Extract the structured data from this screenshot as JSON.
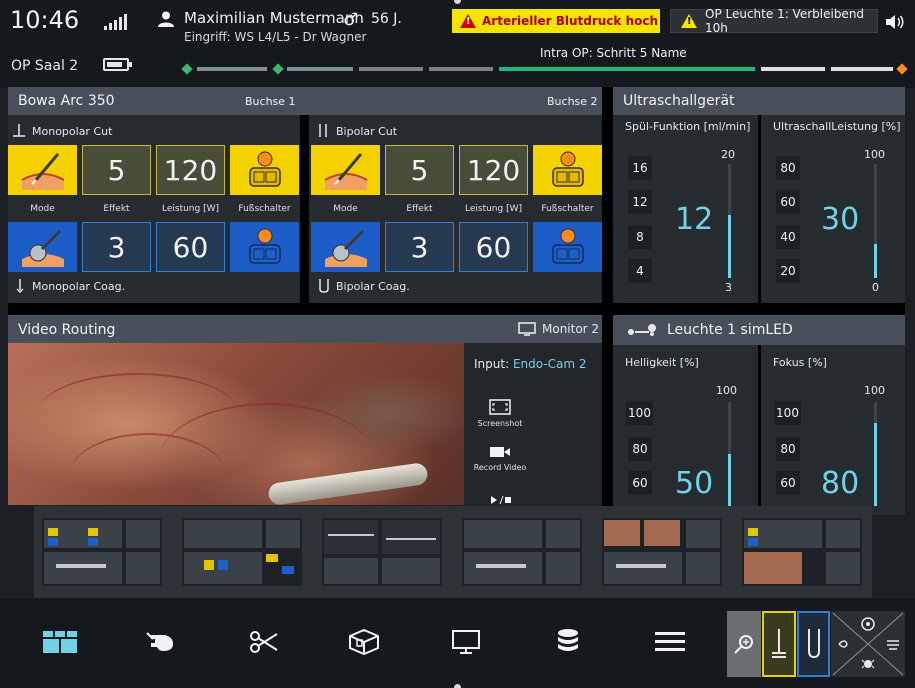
{
  "status": {
    "time": "10:46",
    "room": "OP Saal 2",
    "patient_name": "Maximilian Mustermann",
    "gender_symbol": "♂",
    "age": "56 J.",
    "procedure": "Eingriff: WS L4/L5 - Dr Wagner",
    "alarm_text": "Arterieller Blutdruck hoch",
    "warning_text": "OP Leuchte 1: Verbleibend 10h",
    "step_label": "Intra OP: Schritt 5 Name",
    "battery_level": 0.85,
    "signal_icon": "signal-icon",
    "speaker_icon": "speaker-icon",
    "colors": {
      "alarm_bg": "#f5e400",
      "alarm_text": "#b00000",
      "progress_active": "#1fb87a",
      "accent": "#6fd2e6"
    }
  },
  "hf": {
    "title": "Bowa Arc 350",
    "socket1": "Buchse 1",
    "socket2": "Buchse 2",
    "left": {
      "cut_mode": "Monopolar Cut",
      "coag_mode": "Monopolar Coag.",
      "cut_effect": "5",
      "cut_power": "120",
      "coag_effect": "3",
      "coag_power": "60"
    },
    "right": {
      "cut_mode": "Bipolar Cut",
      "coag_mode": "Bipolar Coag.",
      "cut_effect": "5",
      "cut_power": "120",
      "coag_effect": "3",
      "coag_power": "60"
    },
    "labels": {
      "mode": "Mode",
      "effect": "Effekt",
      "power": "Leistung [W]",
      "footswitch": "Fußschalter"
    }
  },
  "ultrasound": {
    "title": "Ultraschallgerät",
    "rinse": {
      "title": "Spül-Funktion  [ml/min]",
      "value": "12",
      "max": "20",
      "min": "3",
      "presets": [
        "16",
        "12",
        "8",
        "4"
      ],
      "level": 0.55
    },
    "power": {
      "title": "UltraschallLeistung  [%]",
      "value": "30",
      "max": "100",
      "min": "0",
      "presets": [
        "80",
        "60",
        "40",
        "20"
      ],
      "level": 0.3
    }
  },
  "video": {
    "title": "Video Routing",
    "monitor": "Monitor 2",
    "input_label": "Input: ",
    "input_value": "Endo-Cam 2",
    "screenshot": "Screenshot",
    "record": "Record Video",
    "play_icon": "play-stop-icon"
  },
  "light": {
    "title": "Leuchte 1 simLED",
    "brightness": {
      "title": "Helligkeit [%]",
      "value": "50",
      "max": "100",
      "presets": [
        "100",
        "80",
        "60"
      ],
      "level": 0.5
    },
    "focus": {
      "title": "Fokus [%]",
      "value": "80",
      "max": "100",
      "presets": [
        "100",
        "80",
        "60"
      ],
      "level": 0.8
    }
  },
  "nav": {
    "items": [
      "dashboard-icon",
      "patient-icon",
      "instruments-icon",
      "devices-3d-icon",
      "monitor-icon",
      "database-icon",
      "menu-icon"
    ],
    "quick_actions": [
      "zoom-icon",
      "monopolar-icon",
      "bipolar-icon",
      "multi-control-icon"
    ]
  }
}
